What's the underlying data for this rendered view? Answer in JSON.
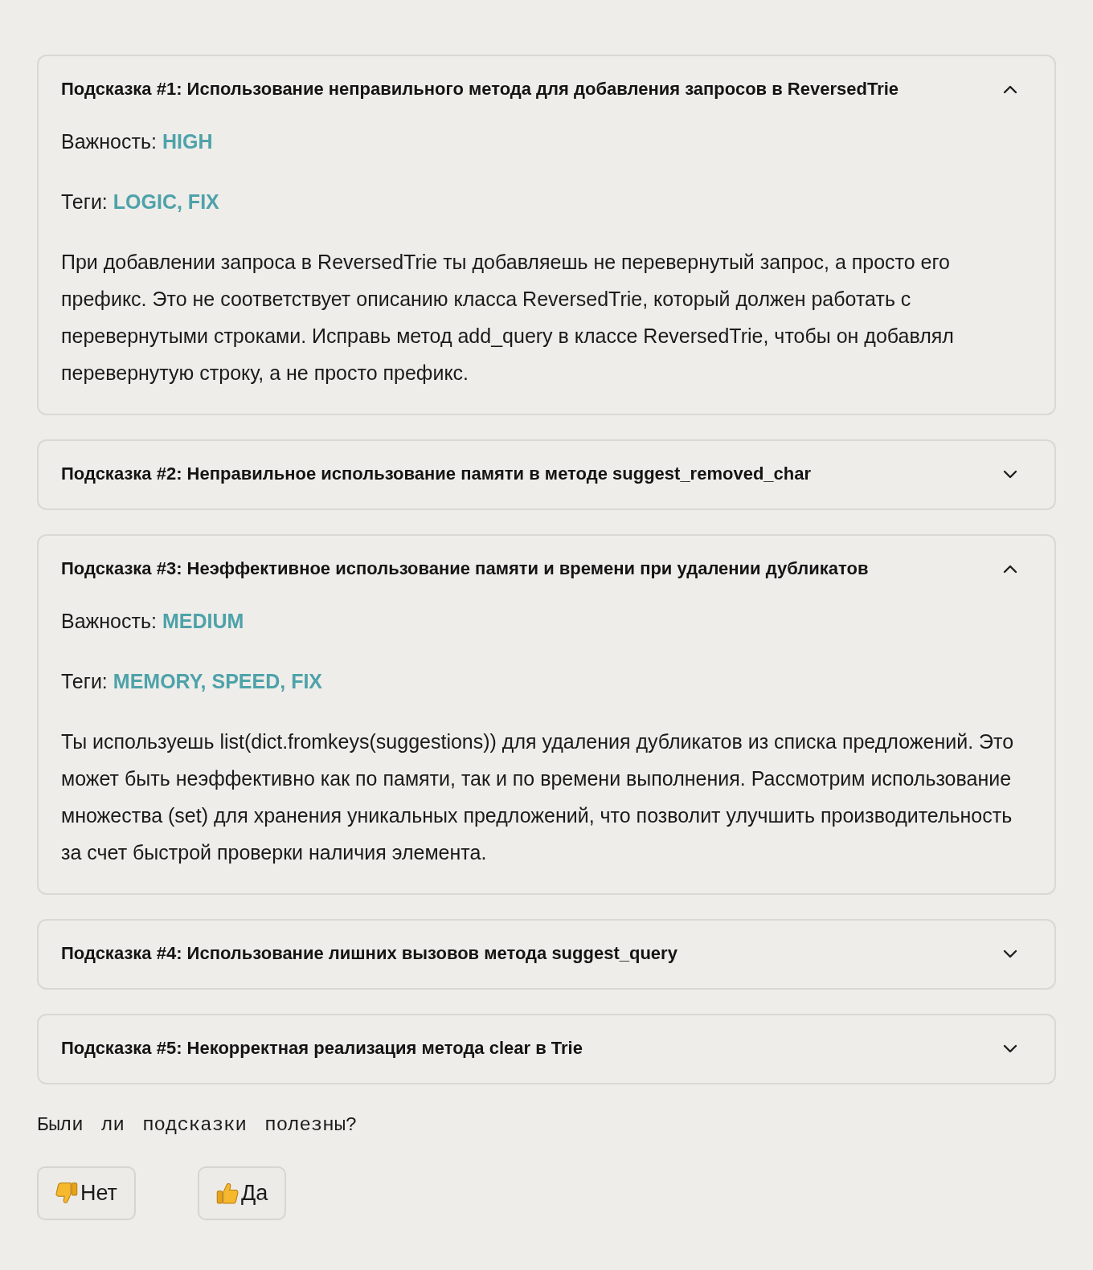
{
  "hints": [
    {
      "title": "Подсказка #1: Использование неправильного метода для добавления запросов в ReversedTrie",
      "expanded": true,
      "severity_label": "Важность:",
      "severity": "HIGH",
      "tags_label": "Теги:",
      "tags": "LOGIC, FIX",
      "text": "При добавлении запроса в ReversedTrie ты добавляешь не перевернутый запрос, а просто его префикс. Это не соответствует описанию класса ReversedTrie, который должен работать с перевернутыми строками. Исправь метод add_query в классе ReversedTrie, чтобы он добавлял перевернутую строку, а не просто префикс."
    },
    {
      "title": "Подсказка #2: Неправильное использование памяти в методе suggest_removed_char",
      "expanded": false
    },
    {
      "title": "Подсказка #3: Неэффективное использование памяти и времени при удалении дубликатов",
      "expanded": true,
      "severity_label": "Важность:",
      "severity": "MEDIUM",
      "tags_label": "Теги:",
      "tags": "MEMORY, SPEED, FIX",
      "text": "Ты используешь list(dict.fromkeys(suggestions)) для удаления дубликатов из списка предложений. Это может быть неэффективно как по памяти, так и по времени выполнения. Рассмотрим использование множества (set) для хранения уникальных предложений, что позволит улучшить производительность за счет быстрой проверки наличия элемента."
    },
    {
      "title": "Подсказка #4: Использование лишних вызовов метода suggest_query",
      "expanded": false
    },
    {
      "title": "Подсказка #5: Некорректная реализация метода clear в Trie",
      "expanded": false
    }
  ],
  "feedback": {
    "question": "Были ли подсказки полезны?",
    "buttons": [
      {
        "kind": "thumbs-down",
        "label": "Нет"
      },
      {
        "kind": "thumbs-up",
        "label": "Да"
      }
    ]
  }
}
